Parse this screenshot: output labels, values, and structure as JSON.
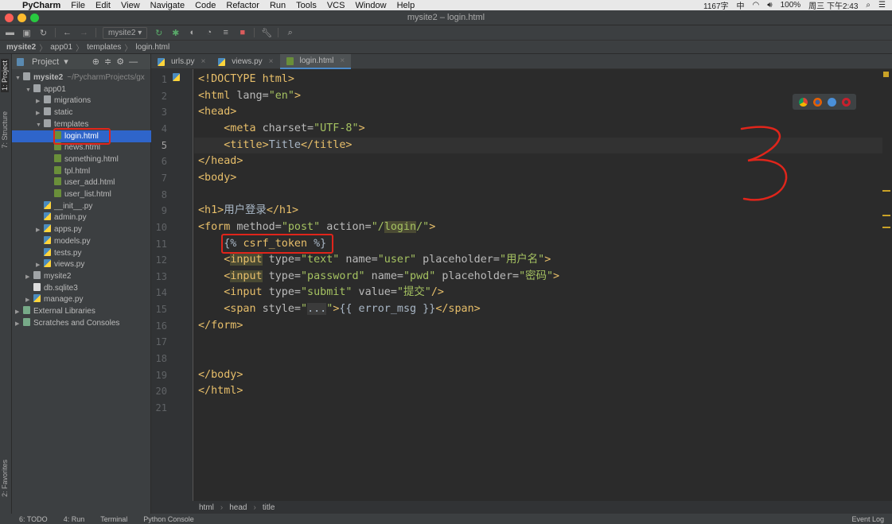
{
  "menubar": {
    "app": "PyCharm",
    "items": [
      "File",
      "Edit",
      "View",
      "Navigate",
      "Code",
      "Refactor",
      "Run",
      "Tools",
      "VCS",
      "Window",
      "Help"
    ],
    "status": {
      "word_count": "1167字",
      "ime": "中",
      "battery": "100%",
      "clock": "周三 下午2:43"
    }
  },
  "window": {
    "title": "mysite2 – login.html"
  },
  "toolbar": {
    "run_config": "mysite2"
  },
  "navbar": {
    "crumbs": [
      "mysite2",
      "app01",
      "templates",
      "login.html"
    ]
  },
  "side_strip": {
    "project": "1: Project",
    "structure": "7: Structure",
    "favorites": "2: Favorites"
  },
  "project": {
    "title": "Project",
    "tree": [
      {
        "label": "mysite2",
        "extra": "~/PycharmProjects/gx",
        "depth": 0,
        "arrow": "down",
        "icon": "folder"
      },
      {
        "label": "app01",
        "depth": 1,
        "arrow": "down",
        "icon": "folder"
      },
      {
        "label": "migrations",
        "depth": 2,
        "arrow": "right",
        "icon": "folder"
      },
      {
        "label": "static",
        "depth": 2,
        "arrow": "right",
        "icon": "folder"
      },
      {
        "label": "templates",
        "depth": 2,
        "arrow": "down",
        "icon": "folder"
      },
      {
        "label": "login.html",
        "depth": 3,
        "icon": "html",
        "selected": true
      },
      {
        "label": "news.html",
        "depth": 3,
        "icon": "html"
      },
      {
        "label": "something.html",
        "depth": 3,
        "icon": "html"
      },
      {
        "label": "tpl.html",
        "depth": 3,
        "icon": "html"
      },
      {
        "label": "user_add.html",
        "depth": 3,
        "icon": "html"
      },
      {
        "label": "user_list.html",
        "depth": 3,
        "icon": "html"
      },
      {
        "label": "__init__.py",
        "depth": 2,
        "icon": "py"
      },
      {
        "label": "admin.py",
        "depth": 2,
        "icon": "py"
      },
      {
        "label": "apps.py",
        "depth": 2,
        "arrow": "right",
        "icon": "py"
      },
      {
        "label": "models.py",
        "depth": 2,
        "icon": "py"
      },
      {
        "label": "tests.py",
        "depth": 2,
        "icon": "py"
      },
      {
        "label": "views.py",
        "depth": 2,
        "arrow": "right",
        "icon": "py"
      },
      {
        "label": "mysite2",
        "depth": 1,
        "arrow": "right",
        "icon": "folder"
      },
      {
        "label": "db.sqlite3",
        "depth": 1,
        "icon": "db"
      },
      {
        "label": "manage.py",
        "depth": 1,
        "arrow": "right",
        "icon": "py"
      },
      {
        "label": "External Libraries",
        "depth": 0,
        "arrow": "right",
        "icon": "lib"
      },
      {
        "label": "Scratches and Consoles",
        "depth": 0,
        "arrow": "right",
        "icon": "lib"
      }
    ]
  },
  "tabs": [
    {
      "label": "urls.py",
      "icon": "py"
    },
    {
      "label": "views.py",
      "icon": "py"
    },
    {
      "label": "login.html",
      "icon": "html",
      "active": true
    }
  ],
  "editor": {
    "current_line": 5,
    "lines": [
      [
        [
          "<!DOCTYPE ",
          "t"
        ],
        [
          "html",
          "t"
        ],
        [
          ">",
          "t"
        ]
      ],
      [
        [
          "<html ",
          "t"
        ],
        [
          "lang=",
          "a"
        ],
        [
          "\"en\"",
          "v"
        ],
        [
          ">",
          "t"
        ]
      ],
      [
        [
          "<head>",
          "t"
        ]
      ],
      [
        [
          "    <meta ",
          "t"
        ],
        [
          "charset=",
          "a"
        ],
        [
          "\"UTF-8\"",
          "v"
        ],
        [
          ">",
          "t"
        ]
      ],
      [
        [
          "    <title>",
          "t"
        ],
        [
          "Title",
          "x"
        ],
        [
          "</title>",
          "t"
        ]
      ],
      [
        [
          "</head>",
          "t"
        ]
      ],
      [
        [
          "<body>",
          "t"
        ]
      ],
      [],
      [
        [
          "<h1>",
          "t"
        ],
        [
          "用户登录",
          "x"
        ],
        [
          "</h1>",
          "t"
        ]
      ],
      [
        [
          "<form ",
          "t"
        ],
        [
          "method=",
          "a"
        ],
        [
          "\"post\"",
          "v"
        ],
        [
          " action=",
          "a"
        ],
        [
          "\"/",
          "v"
        ],
        [
          "login",
          "v hl"
        ],
        [
          "/\"",
          "v"
        ],
        [
          ">",
          "t"
        ]
      ],
      [
        [
          "    ",
          "x"
        ],
        [
          "{% ",
          "tm"
        ],
        [
          "csrf_token",
          "t"
        ],
        [
          " %}",
          "tm"
        ]
      ],
      [
        [
          "    <",
          "t"
        ],
        [
          "input",
          "t hl"
        ],
        [
          " type=",
          "a"
        ],
        [
          "\"text\"",
          "v"
        ],
        [
          " name=",
          "a"
        ],
        [
          "\"user\"",
          "v"
        ],
        [
          " placeholder=",
          "a"
        ],
        [
          "\"用户名\"",
          "v"
        ],
        [
          ">",
          "t"
        ]
      ],
      [
        [
          "    <",
          "t"
        ],
        [
          "input",
          "t hl"
        ],
        [
          " type=",
          "a"
        ],
        [
          "\"password\"",
          "v"
        ],
        [
          " name=",
          "a"
        ],
        [
          "\"pwd\"",
          "v"
        ],
        [
          " placeholder=",
          "a"
        ],
        [
          "\"密码\"",
          "v"
        ],
        [
          ">",
          "t"
        ]
      ],
      [
        [
          "    <input ",
          "t"
        ],
        [
          "type=",
          "a"
        ],
        [
          "\"submit\"",
          "v"
        ],
        [
          " value=",
          "a"
        ],
        [
          "\"提交\"",
          "v"
        ],
        [
          "/>",
          "t"
        ]
      ],
      [
        [
          "    <span ",
          "t"
        ],
        [
          "style=",
          "a"
        ],
        [
          "\"",
          "v"
        ],
        [
          "...",
          "x fold"
        ],
        [
          "\"",
          "v"
        ],
        [
          ">",
          "t"
        ],
        [
          "{{ error_msg }}",
          "x"
        ],
        [
          "</span>",
          "t"
        ]
      ],
      [
        [
          "</form>",
          "t"
        ]
      ],
      [],
      [],
      [
        [
          "</body>",
          "t"
        ]
      ],
      [
        [
          "</html>",
          "t"
        ]
      ],
      []
    ]
  },
  "bottom_breadcrumb": [
    "html",
    "head",
    "title"
  ],
  "statusbar": {
    "todo": "6: TODO",
    "run": "4: Run",
    "terminal": "Terminal",
    "python_console": "Python Console",
    "event_log": "Event Log"
  },
  "browsers": [
    "chrome",
    "firefox",
    "safari",
    "opera"
  ],
  "annotation": {
    "handwritten": "3",
    "color": "#e0251b"
  }
}
